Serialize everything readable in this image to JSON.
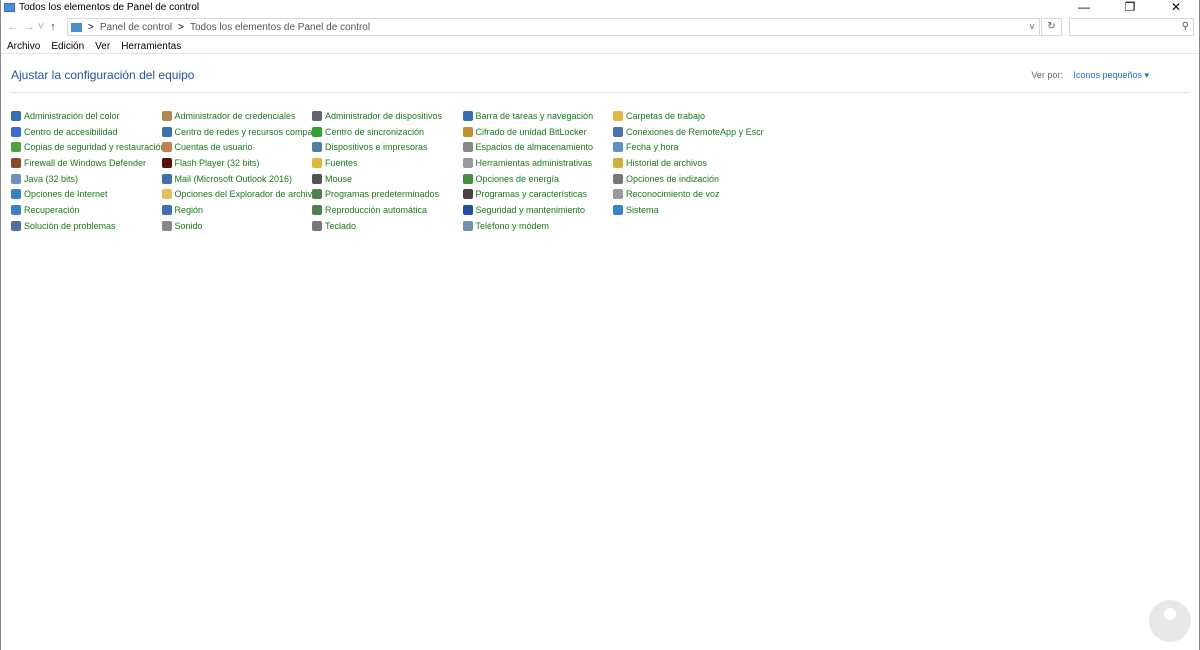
{
  "window": {
    "title": "Todos los elementos de Panel de control",
    "controls": [
      "—",
      "❐",
      "✕"
    ]
  },
  "address": {
    "back": "←",
    "forward": "→",
    "recent": "˅",
    "up": "↑",
    "breadcrumb": [
      "Panel de control",
      "Todos los elementos de Panel de control"
    ],
    "separator": ">",
    "dropdown": "˅",
    "refresh": "↻",
    "search_icon": "⚲",
    "search_placeholder": ""
  },
  "menu": [
    "Archivo",
    "Edición",
    "Ver",
    "Herramientas"
  ],
  "header": {
    "title": "Ajustar la configuración del equipo",
    "view_by_label": "Ver por:",
    "view_by_value": "Iconos pequeños ▾"
  },
  "items": [
    {
      "label": "Administración del color",
      "color": "#3a6fb0"
    },
    {
      "label": "Administrador de credenciales",
      "color": "#b08850"
    },
    {
      "label": "Administrador de dispositivos",
      "color": "#666666"
    },
    {
      "label": "Barra de tareas y navegación",
      "color": "#3a6fb0"
    },
    {
      "label": "Carpetas de trabajo",
      "color": "#e0b840"
    },
    {
      "label": "Centro de accesibilidad",
      "color": "#3a6fd0"
    },
    {
      "label": "Centro de redes y recursos comparti...",
      "color": "#3a6fb0"
    },
    {
      "label": "Centro de sincronización",
      "color": "#30a030"
    },
    {
      "label": "Cifrado de unidad BitLocker",
      "color": "#c09030"
    },
    {
      "label": "Conexiones de RemoteApp y Escrito...",
      "color": "#4a6fb0"
    },
    {
      "label": "Copias de seguridad y restauración (...",
      "color": "#50a040"
    },
    {
      "label": "Cuentas de usuario",
      "color": "#c08050"
    },
    {
      "label": "Dispositivos e impresoras",
      "color": "#5080a0"
    },
    {
      "label": "Espacios de almacenamiento",
      "color": "#888888"
    },
    {
      "label": "Fecha y hora",
      "color": "#6090c0"
    },
    {
      "label": "Firewall de Windows Defender",
      "color": "#8a4a2a"
    },
    {
      "label": "Flash Player (32 bits)",
      "color": "#5a1010"
    },
    {
      "label": "Fuentes",
      "color": "#e0b840"
    },
    {
      "label": "Herramientas administrativas",
      "color": "#999999"
    },
    {
      "label": "Historial de archivos",
      "color": "#d0b040"
    },
    {
      "label": "Java (32 bits)",
      "color": "#7090c0"
    },
    {
      "label": "Mail (Microsoft Outlook 2016)",
      "color": "#4070b0"
    },
    {
      "label": "Mouse",
      "color": "#555555"
    },
    {
      "label": "Opciones de energía",
      "color": "#409040"
    },
    {
      "label": "Opciones de indización",
      "color": "#777777"
    },
    {
      "label": "Opciones de Internet",
      "color": "#3a80c0"
    },
    {
      "label": "Opciones del Explorador de archivos",
      "color": "#e0c060"
    },
    {
      "label": "Programas predeterminados",
      "color": "#508050"
    },
    {
      "label": "Programas y características",
      "color": "#444444"
    },
    {
      "label": "Reconocimiento de voz",
      "color": "#999999"
    },
    {
      "label": "Recuperación",
      "color": "#3a80c0"
    },
    {
      "label": "Región",
      "color": "#4070b0"
    },
    {
      "label": "Reproducción automática",
      "color": "#508050"
    },
    {
      "label": "Seguridad y mantenimiento",
      "color": "#2050a0"
    },
    {
      "label": "Sistema",
      "color": "#3a80d0"
    },
    {
      "label": "Solución de problemas",
      "color": "#5070a0"
    },
    {
      "label": "Sonido",
      "color": "#888888"
    },
    {
      "label": "Teclado",
      "color": "#777777"
    },
    {
      "label": "Teléfono y módem",
      "color": "#7090b0"
    }
  ]
}
